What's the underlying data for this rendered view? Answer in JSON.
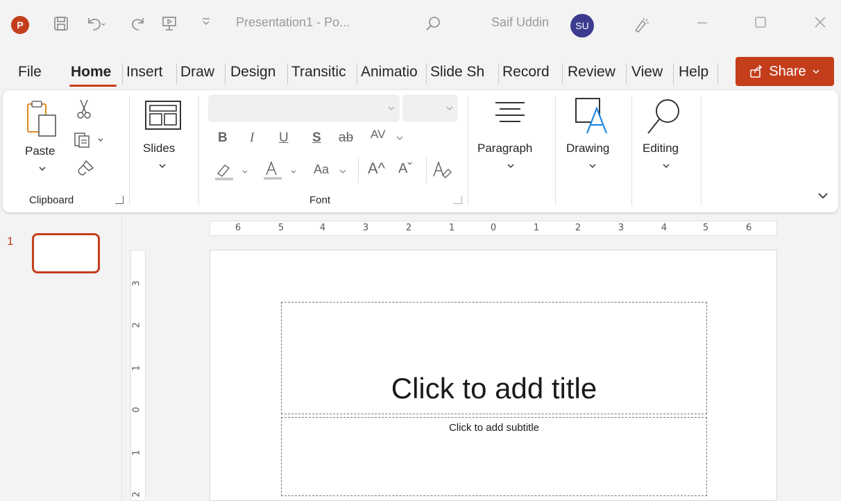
{
  "titlebar": {
    "app_logo": "P",
    "doc_title": "Presentation1 - Po...",
    "user_name": "Saif Uddin",
    "avatar_initials": "SU",
    "icons": [
      "save-icon",
      "undo-icon",
      "redo-icon",
      "present-icon",
      "customize-icon",
      "search-icon",
      "ideas-icon",
      "minimize-icon",
      "maximize-icon",
      "close-icon"
    ]
  },
  "tabs": [
    "File",
    "Home",
    "Insert",
    "Draw",
    "Design",
    "Transitic",
    "Animatio",
    "Slide Sh",
    "Record",
    "Review",
    "View",
    "Help"
  ],
  "share_label": "Share",
  "ribbon": {
    "paste_label": "Paste",
    "clipboard_label": "Clipboard",
    "slides_label": "Slides",
    "font_label": "Font",
    "font_buttons": [
      "B",
      "I",
      "U",
      "S",
      "ab",
      "AV",
      "Aa",
      "A^",
      "Aˇ"
    ],
    "paragraph_label": "Paragraph",
    "drawing_label": "Drawing",
    "editing_label": "Editing"
  },
  "slide_panel": {
    "slide_number": "1"
  },
  "ruler": {
    "horizontal": [
      "6",
      "5",
      "4",
      "3",
      "2",
      "1",
      "0",
      "1",
      "2",
      "3",
      "4",
      "5",
      "6"
    ],
    "vertical": [
      "3",
      "2",
      "1",
      "0",
      "1",
      "2"
    ]
  },
  "slide": {
    "title_placeholder": "Click to add title",
    "subtitle_placeholder": "Click to add subtitle"
  },
  "colors": {
    "accent": "#c43e1c",
    "avatar": "#3b3b8f"
  }
}
